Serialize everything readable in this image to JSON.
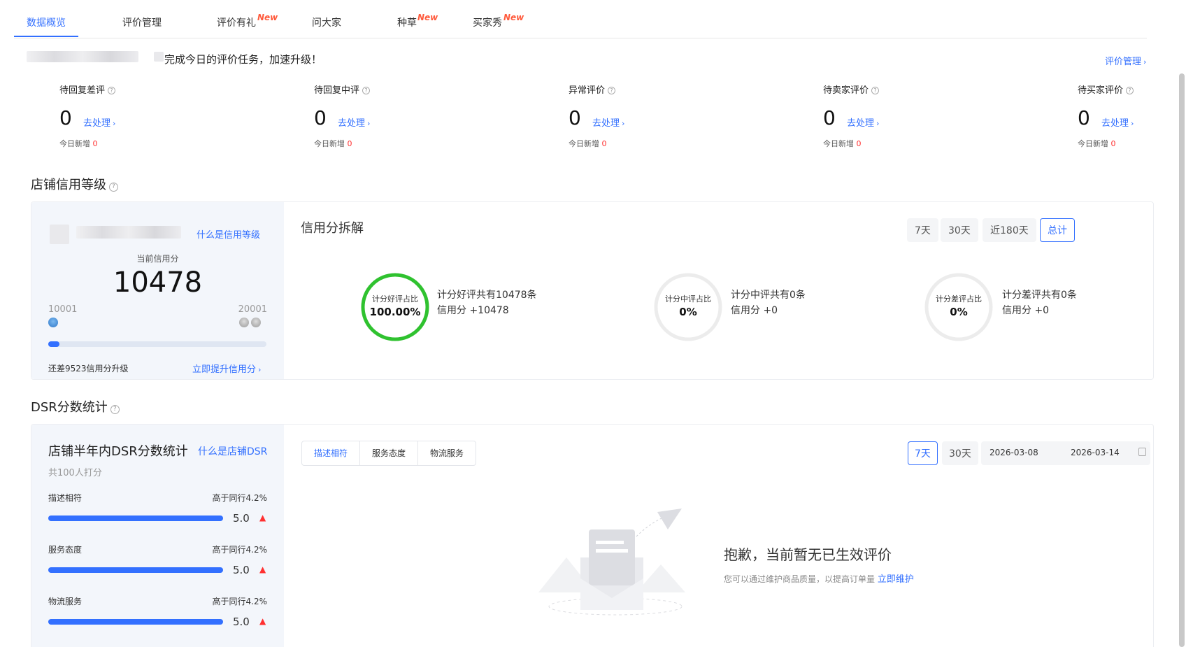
{
  "tabs": [
    {
      "label": "数据概览",
      "active": true
    },
    {
      "label": "评价管理"
    },
    {
      "label": "评价有礼",
      "badge": "New"
    },
    {
      "label": "问大家"
    },
    {
      "label": "种草",
      "badge": "New"
    },
    {
      "label": "买家秀",
      "badge": "New"
    }
  ],
  "banner": {
    "task_text": "完成今日的评价任务，加速升级！",
    "manage_link": "评价管理"
  },
  "stats": [
    {
      "label": "待回复差评",
      "value": "0",
      "action": "去处理",
      "today_label": "今日新增",
      "today_value": "0"
    },
    {
      "label": "待回复中评",
      "value": "0",
      "action": "去处理",
      "today_label": "今日新增",
      "today_value": "0"
    },
    {
      "label": "异常评价",
      "value": "0",
      "action": "去处理",
      "today_label": "今日新增",
      "today_value": "0"
    },
    {
      "label": "待卖家评价",
      "value": "0",
      "action": "去处理",
      "today_label": "今日新增",
      "today_value": "0"
    },
    {
      "label": "待买家评价",
      "value": "0",
      "action": "去处理",
      "today_label": "今日新增",
      "today_value": "0"
    }
  ],
  "credit": {
    "section_title": "店铺信用等级",
    "what_link": "什么是信用等级",
    "current_label": "当前信用分",
    "score": "10478",
    "range_min": "10001",
    "range_max": "20001",
    "progress": 0.05,
    "gap_text": "还差9523信用分升级",
    "improve_link": "立即提升信用分",
    "breakdown_title": "信用分拆解",
    "periods": [
      "7天",
      "30天",
      "近180天",
      "总计"
    ],
    "active_period": "总计",
    "rings": [
      {
        "label": "计分好评占比",
        "value": "100.00%",
        "ratio": 1.0,
        "color": "#2fc22f",
        "line1": "计分好评共有10478条",
        "line2": "信用分 +10478"
      },
      {
        "label": "计分中评占比",
        "value": "0%",
        "ratio": 0,
        "color": "#2fc22f",
        "line1": "计分中评共有0条",
        "line2": "信用分 +0"
      },
      {
        "label": "计分差评占比",
        "value": "0%",
        "ratio": 0,
        "color": "#2fc22f",
        "line1": "计分差评共有0条",
        "line2": "信用分 +0"
      }
    ]
  },
  "dsr": {
    "section_title": "DSR分数统计",
    "box_title": "店铺半年内DSR分数统计",
    "what_link": "什么是店铺DSR",
    "raters": "共100人打分",
    "items": [
      {
        "label": "描述相符",
        "compare": "高于同行4.2%",
        "score": "5.0",
        "ratio": 1.0
      },
      {
        "label": "服务态度",
        "compare": "高于同行4.2%",
        "score": "5.0",
        "ratio": 1.0
      },
      {
        "label": "物流服务",
        "compare": "高于同行4.2%",
        "score": "5.0",
        "ratio": 1.0
      }
    ],
    "toggles": [
      "描述相符",
      "服务态度",
      "物流服务"
    ],
    "active_toggle": "描述相符",
    "periods": [
      "7天",
      "30天"
    ],
    "active_period": "7天",
    "date_start": "2026-03-08",
    "date_end": "2026-03-14",
    "empty_title": "抱歉，当前暂无已生效评价",
    "empty_desc": "您可以通过维护商品质量，以提高订单量",
    "empty_link": "立即维护"
  },
  "colors": {
    "accent": "#3370ff",
    "good": "#2fc22f",
    "alert": "#ff3030",
    "new_badge": "#ff5a3c"
  }
}
